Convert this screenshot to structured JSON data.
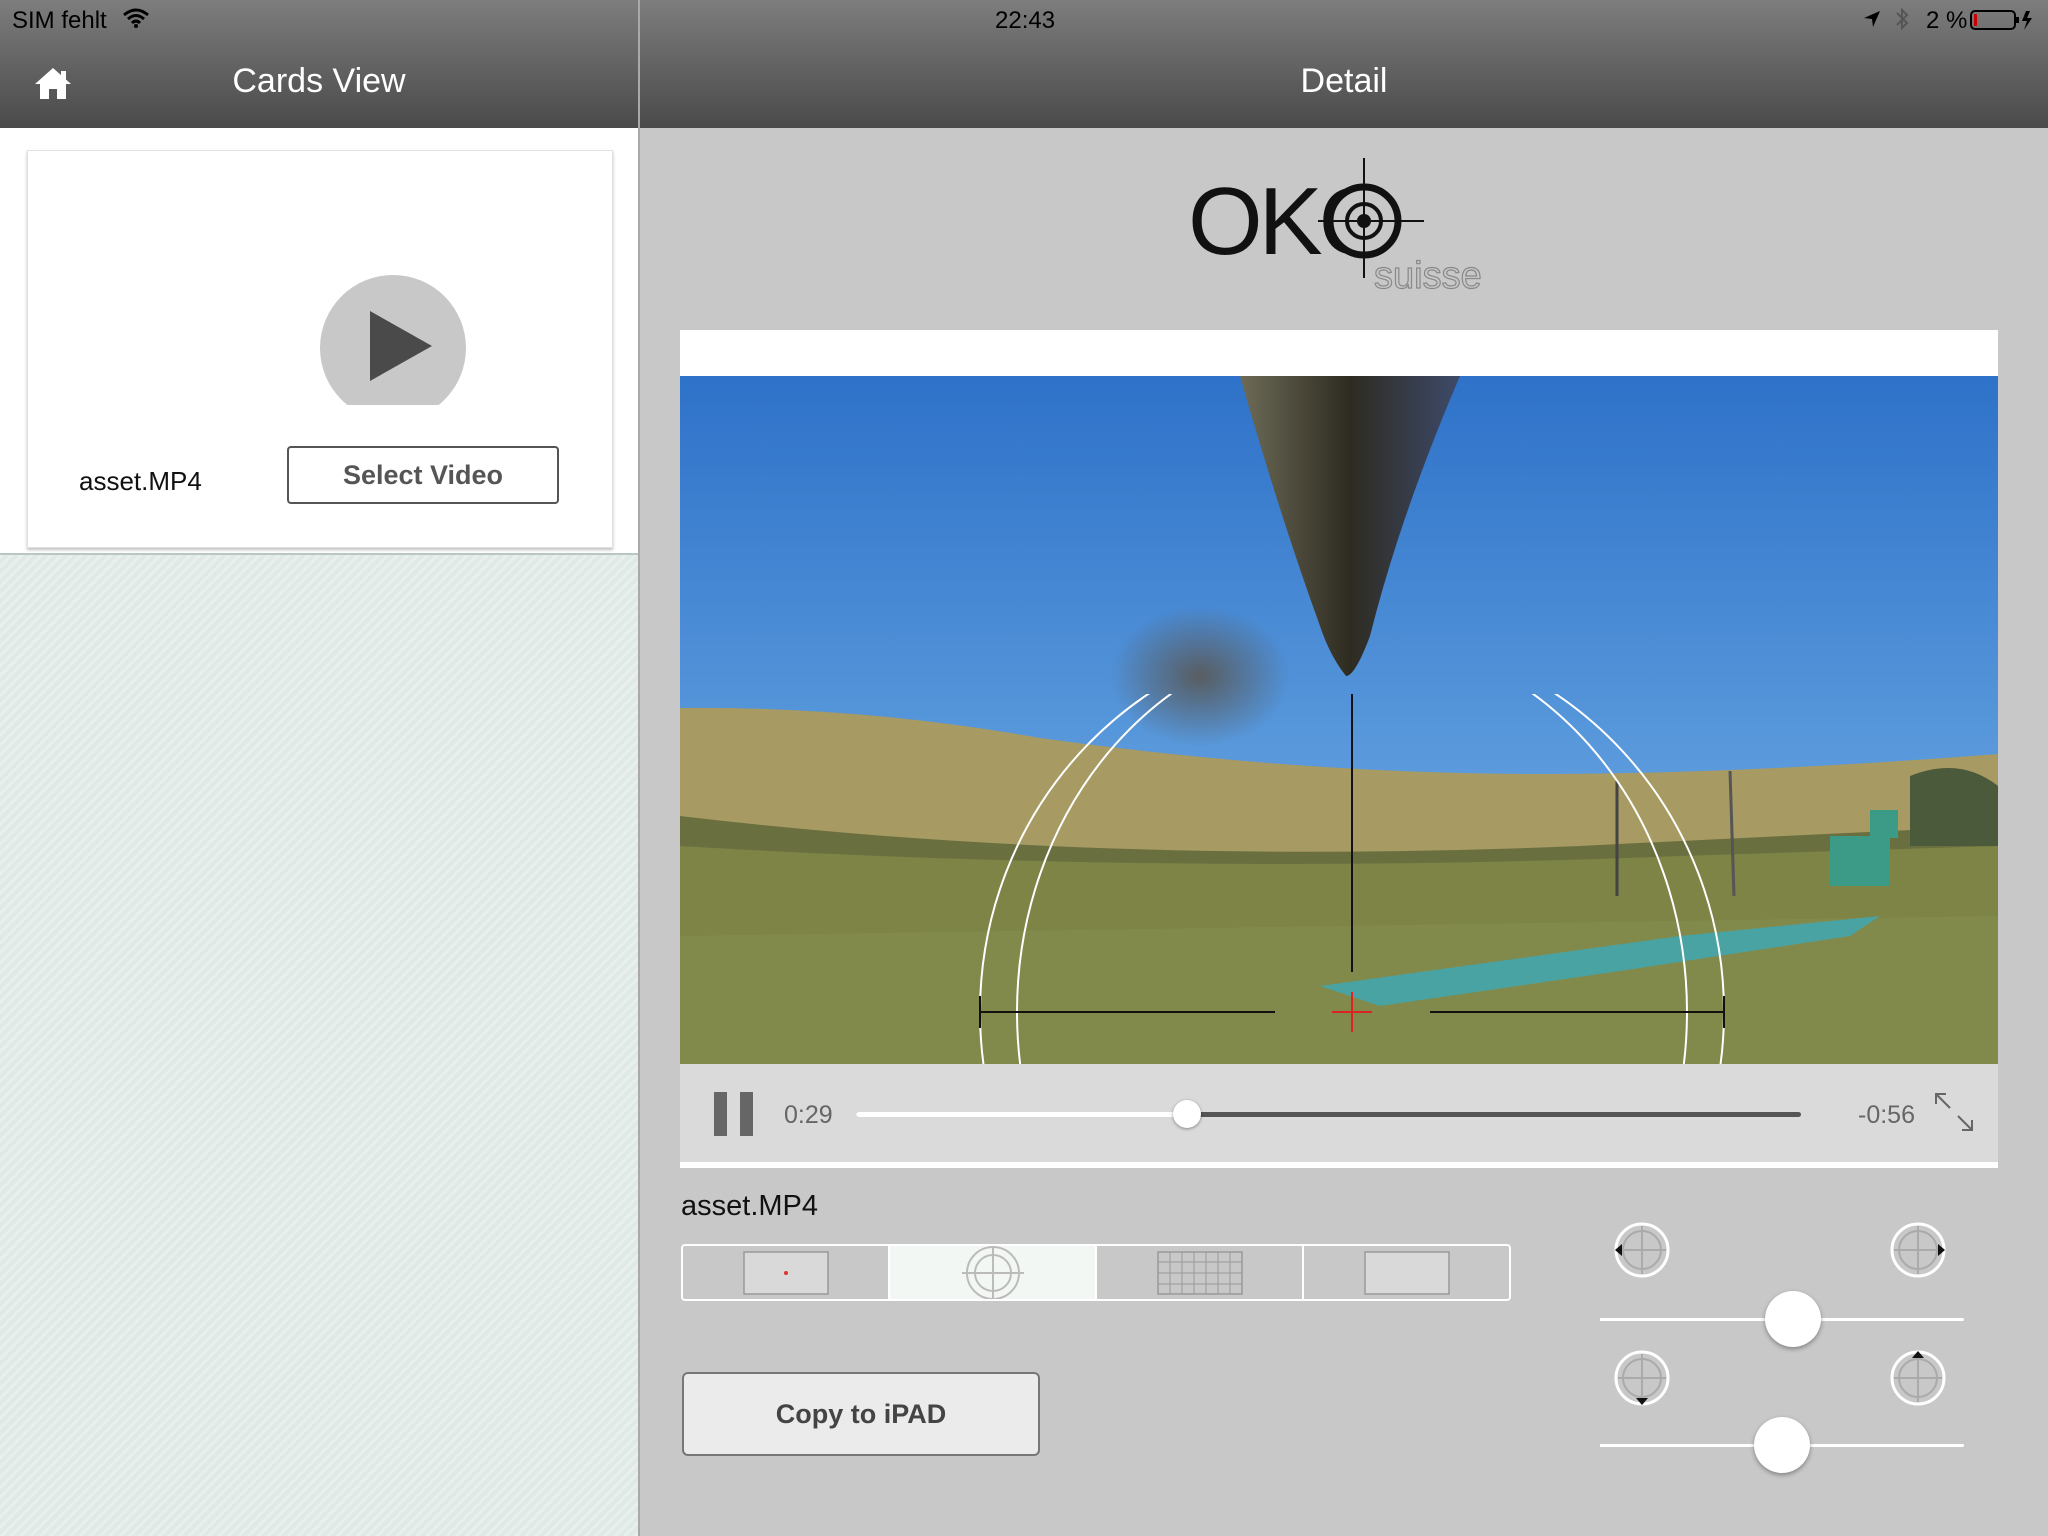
{
  "status_bar": {
    "carrier": "SIM fehlt",
    "time": "22:43",
    "battery": "2 %"
  },
  "master": {
    "title": "Cards View",
    "card": {
      "filename": "asset.MP4",
      "select_label": "Select Video"
    }
  },
  "detail": {
    "title": "Detail",
    "logo": {
      "brand": "OKO",
      "sub": "suisse"
    },
    "player": {
      "elapsed": "0:29",
      "remaining": "-0:56",
      "progress_fraction": 0.35,
      "state": "playing"
    },
    "filename": "asset.MP4",
    "reticle_options": {
      "selected_index": 1,
      "icons": [
        "red-dot-reticle-icon",
        "circle-crosshair-reticle-icon",
        "grid-reticle-icon",
        "blank-reticle-icon"
      ]
    },
    "copy_label": "Copy to iPAD",
    "adjust": {
      "horizontal_fraction": 0.53,
      "vertical_fraction": 0.5
    }
  },
  "colors": {
    "nav_bar": "#5e5e5e",
    "panel_background": "#c8c8c8",
    "sidebar_background": "#dfe9e5"
  }
}
